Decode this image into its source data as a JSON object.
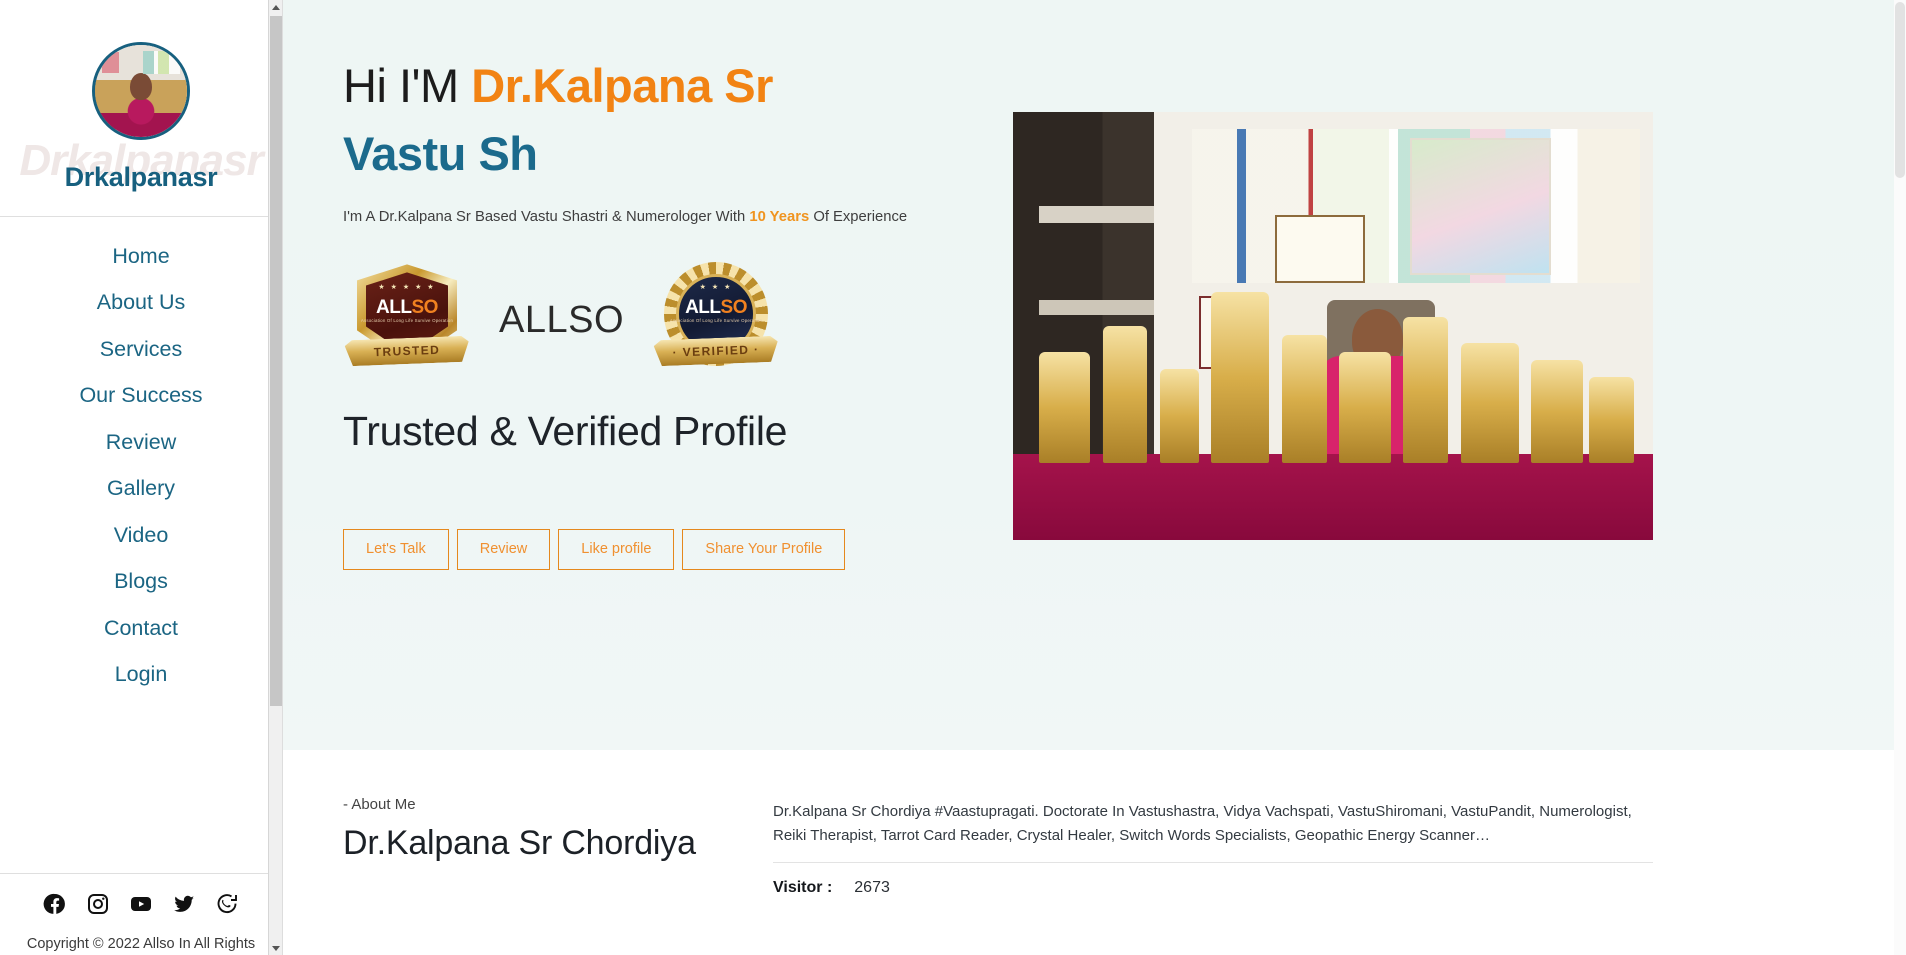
{
  "sidebar": {
    "brand_name": "Drkalpanasr",
    "brand_watermark": "Drkalpanasr",
    "avatar_name": "profile-avatar",
    "nav_items": [
      {
        "label": "Home"
      },
      {
        "label": "About Us"
      },
      {
        "label": "Services"
      },
      {
        "label": "Our Success"
      },
      {
        "label": "Review"
      },
      {
        "label": "Gallery"
      },
      {
        "label": "Video"
      },
      {
        "label": "Blogs"
      },
      {
        "label": "Contact"
      },
      {
        "label": "Login"
      }
    ],
    "socials": [
      {
        "name": "facebook-icon"
      },
      {
        "name": "instagram-icon"
      },
      {
        "name": "youtube-icon"
      },
      {
        "name": "twitter-icon"
      },
      {
        "name": "whatsapp-icon"
      }
    ],
    "copyright": "Copyright © 2022 Allso In All Rights"
  },
  "hero": {
    "greeting": "Hi I'M",
    "name_accent": "Dr.Kalpana Sr",
    "title_line2": "Vastu Sh",
    "subtitle_before": "I'm A Dr.Kalpana Sr Based Vastu Shastri & Numerologer With",
    "subtitle_years": "10 Years",
    "subtitle_after": "Of Experience",
    "badges": [
      {
        "brand": "ALLSO",
        "brand_white": "ALL",
        "brand_orange": "SO",
        "ribbon": "TRUSTED",
        "stars": "★ ★ ★ ★ ★",
        "tagline": "Association Of Long Life Survive Operation"
      },
      {
        "brand": "ALLSO",
        "brand_white": "ALL",
        "brand_orange": "SO",
        "ribbon": "· VERIFIED ·",
        "stars": "★ ★ ★",
        "tagline": "Association Of Long Life Survive Operation"
      }
    ],
    "allso_word": "ALLSO",
    "trusted_heading": "Trusted & Verified Profile",
    "buttons": [
      {
        "label": "Let's Talk"
      },
      {
        "label": "Review"
      },
      {
        "label": "Like profile"
      },
      {
        "label": "Share Your Profile"
      }
    ],
    "photo_alt": "Dr.Kalpana Sr Chordiya with awards and trophies"
  },
  "about": {
    "kicker": "- About Me",
    "name": "Dr.Kalpana Sr Chordiya",
    "description": "Dr.Kalpana Sr Chordiya #Vaastupragati. Doctorate In Vastushastra, Vidya Vachspati, VastuShiromani, VastuPandit, Numerologist, Reiki Therapist, Tarrot Card Reader, Crystal Healer, Switch Words Specialists, Geopathic Energy Scanner…",
    "visitor_label": "Visitor :",
    "visitor_count": "2673"
  },
  "colors": {
    "accent_orange": "#f28313",
    "brand_teal": "#1b6a8c",
    "hero_bg": "#eef6f4",
    "button_border": "#e5881d"
  }
}
